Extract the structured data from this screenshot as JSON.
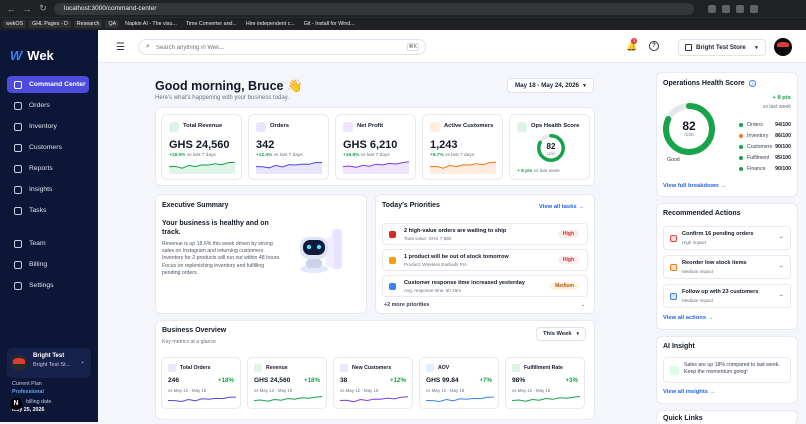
{
  "browser": {
    "url": "localhost:3000/command-center"
  },
  "bookmarks": [
    "wekOS",
    "GHL Pages - D",
    "Research",
    "QA",
    "Napkin AI - The visu...",
    "Time Converter and...",
    "Hire independent c...",
    "Git - Install for Wind..."
  ],
  "sidebar": {
    "brand": "Wek",
    "items": [
      {
        "label": "Command Center",
        "active": true
      },
      {
        "label": "Orders"
      },
      {
        "label": "Inventory"
      },
      {
        "label": "Customers"
      },
      {
        "label": "Reports"
      },
      {
        "label": "Insights"
      },
      {
        "label": "Tasks"
      },
      {
        "label": "Team"
      },
      {
        "label": "Billing"
      },
      {
        "label": "Settings"
      }
    ],
    "user": {
      "name": "Bright Test",
      "store": "Bright Test St...",
      "plan_label": "Current Plan",
      "plan": "Professional",
      "billing_label": "billing date",
      "billing_date": "May 25, 2026"
    }
  },
  "header": {
    "search_placeholder": "Search anything in Wek...",
    "shortcut": "⌘K",
    "notif_count": "3",
    "store": "Bright Test Store"
  },
  "greeting": {
    "title": "Good morning, Bruce 👋",
    "subtitle": "Here's what's happening with your business today.",
    "date_range": "May 18 - May 24, 2026"
  },
  "kpis": [
    {
      "title": "Total Revenue",
      "value": "GHS 24,560",
      "change": "+18.6%",
      "suffix": "vs last 7 days",
      "color": "#16a34a"
    },
    {
      "title": "Orders",
      "value": "342",
      "change": "+12.4%",
      "suffix": "vs last 7 days",
      "color": "#4f46e5"
    },
    {
      "title": "Net Profit",
      "value": "GHS 6,210",
      "change": "+16.8%",
      "suffix": "vs last 7 days",
      "color": "#7c3aed"
    },
    {
      "title": "Active Customers",
      "value": "1,243",
      "change": "+9.7%",
      "suffix": "vs last 7 days",
      "color": "#f97316"
    },
    {
      "title": "Ops Health Score",
      "value": "82",
      "total": "/100",
      "change": "+ 8 pts",
      "suffix": "vs last week",
      "color": "#16a34a",
      "score": 82
    }
  ],
  "exec": {
    "title": "Executive Summary",
    "headline": "Your business is healthy and on track.",
    "body": "Revenue is up 18.6% this week driven by strong sales on Instagram and returning customers. Inventory for 2 products will run out within 48 hours. Focus on replenishing inventory and fulfilling pending orders."
  },
  "priorities": {
    "title": "Today's Priorities",
    "view_all": "View all tasks →",
    "items": [
      {
        "title": "2 high-value orders are waiting to ship",
        "sub": "Total value: GHS 7,880",
        "level": "High",
        "color": "#dc2626"
      },
      {
        "title": "1 product will be out of stock tomorrow",
        "sub": "Product: Wireless Earbuds Pro",
        "level": "High",
        "color": "#f59e0b"
      },
      {
        "title": "Customer response time increased yesterday",
        "sub": "Avg. response time: 6h 45m",
        "level": "Medium",
        "color": "#3b82f6"
      }
    ],
    "more": "+2 more priorities"
  },
  "overview": {
    "title": "Business Overview",
    "subtitle": "Key metrics at a glance",
    "period": "This Week",
    "cards": [
      {
        "title": "Total Orders",
        "value": "246",
        "change": "+18%",
        "sub": "vs May 12 - May 18",
        "color": "#4f46e5"
      },
      {
        "title": "Revenue",
        "value": "GHS 24,560",
        "change": "+18%",
        "sub": "vs May 12 - May 18",
        "color": "#16a34a"
      },
      {
        "title": "New Customers",
        "value": "38",
        "change": "+12%",
        "sub": "vs May 12 - May 18",
        "color": "#7c3aed"
      },
      {
        "title": "AOV",
        "value": "GHS 99.84",
        "change": "+7%",
        "sub": "vs May 12 - May 18",
        "color": "#3b82f6"
      },
      {
        "title": "Fulfillment Rate",
        "value": "98%",
        "change": "+3%",
        "sub": "vs May 12 - May 18",
        "color": "#16a34a"
      }
    ]
  },
  "ops_health": {
    "title": "Operations Health Score",
    "score": "82",
    "total": "/100",
    "status": "Good",
    "change": "+ 8 pts",
    "change_suffix": "vs last week",
    "rows": [
      {
        "label": "Orders",
        "value": "94/100",
        "color": "#16a34a"
      },
      {
        "label": "Inventory",
        "value": "86/100",
        "color": "#f97316"
      },
      {
        "label": "Customers",
        "value": "90/100",
        "color": "#16a34a"
      },
      {
        "label": "Fulfilment",
        "value": "95/100",
        "color": "#16a34a"
      },
      {
        "label": "Finance",
        "value": "90/100",
        "color": "#16a34a"
      }
    ],
    "link": "View full breakdown →"
  },
  "actions": {
    "title": "Recommended Actions",
    "items": [
      {
        "title": "Confirm 16 pending orders",
        "sub": "High impact",
        "color": "#ef4444"
      },
      {
        "title": "Reorder low stock items",
        "sub": "Medium impact",
        "color": "#f97316"
      },
      {
        "title": "Follow up with 23 customers",
        "sub": "Medium impact",
        "color": "#3b82f6"
      }
    ],
    "link": "View all actions →"
  },
  "ai_insight": {
    "title": "AI Insight",
    "text": "Sales are up 18% compared to last week. Keep the momentum going!",
    "link": "View all insights →"
  },
  "quick_links": {
    "title": "Quick Links"
  }
}
